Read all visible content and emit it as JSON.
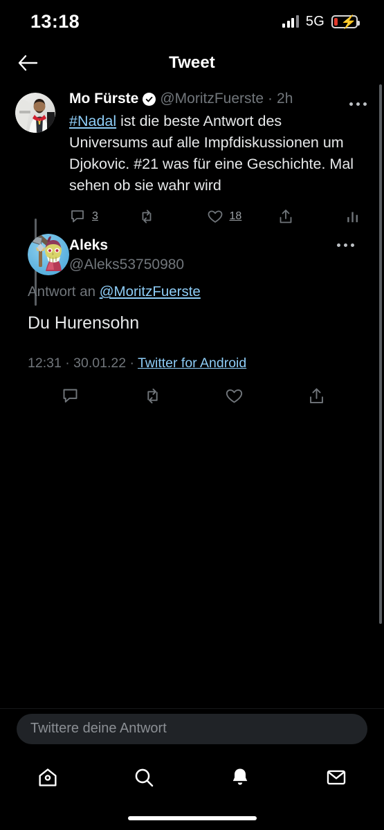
{
  "status_bar": {
    "time": "13:18",
    "network": "5G",
    "signal_icon": "cellular-bars-icon",
    "battery_icon": "battery-charging-icon"
  },
  "header": {
    "title": "Tweet",
    "back_icon": "back-arrow-icon"
  },
  "thread": {
    "parent_tweet": {
      "display_name": "Mo Fürste",
      "verified": true,
      "verified_icon": "verified-badge-icon",
      "handle": "@MoritzFuerste",
      "separator": "·",
      "timestamp": "2h",
      "avatar_name": "avatar-mo-fuerste",
      "text_link": "#Nadal",
      "text_rest": " ist die beste Antwort des Universums auf alle Impfdiskussionen um Djokovic. #21 was für eine Geschichte. Mal sehen ob sie wahr wird",
      "more_icon": "more-options-icon",
      "actions": {
        "reply_icon": "reply-icon",
        "reply_count": "3",
        "retweet_icon": "retweet-icon",
        "retweet_count": "",
        "like_icon": "like-heart-icon",
        "like_count": "18",
        "share_icon": "share-icon",
        "analytics_icon": "analytics-bars-icon"
      }
    },
    "reply_tweet": {
      "display_name": "Aleks",
      "handle": "@Aleks53750980",
      "avatar_name": "avatar-aleks",
      "more_icon": "more-options-icon",
      "reply_to_prefix": "Antwort an",
      "reply_to_handle": "@MoritzFuerste",
      "text": "Du Hurensohn",
      "meta_time": "12:31",
      "meta_sep1": "·",
      "meta_date": "30.01.22",
      "meta_sep2": "·",
      "meta_client": "Twitter for Android",
      "actions": {
        "reply_icon": "reply-icon",
        "retweet_icon": "retweet-icon",
        "like_icon": "like-heart-icon",
        "share_icon": "share-icon"
      }
    }
  },
  "composer": {
    "placeholder": "Twittere deine Antwort"
  },
  "bottom_nav": {
    "items": [
      {
        "name": "home",
        "icon": "home-icon",
        "active": false
      },
      {
        "name": "search",
        "icon": "search-icon",
        "active": false
      },
      {
        "name": "notifications",
        "icon": "bell-icon",
        "active": true
      },
      {
        "name": "messages",
        "icon": "envelope-icon",
        "active": false
      }
    ]
  },
  "colors": {
    "background": "#000000",
    "text_primary": "#e7e9ea",
    "text_secondary": "#71767b",
    "link": "#8ecdf7",
    "composer_bg": "#202327",
    "battery_low": "#e0392b"
  }
}
